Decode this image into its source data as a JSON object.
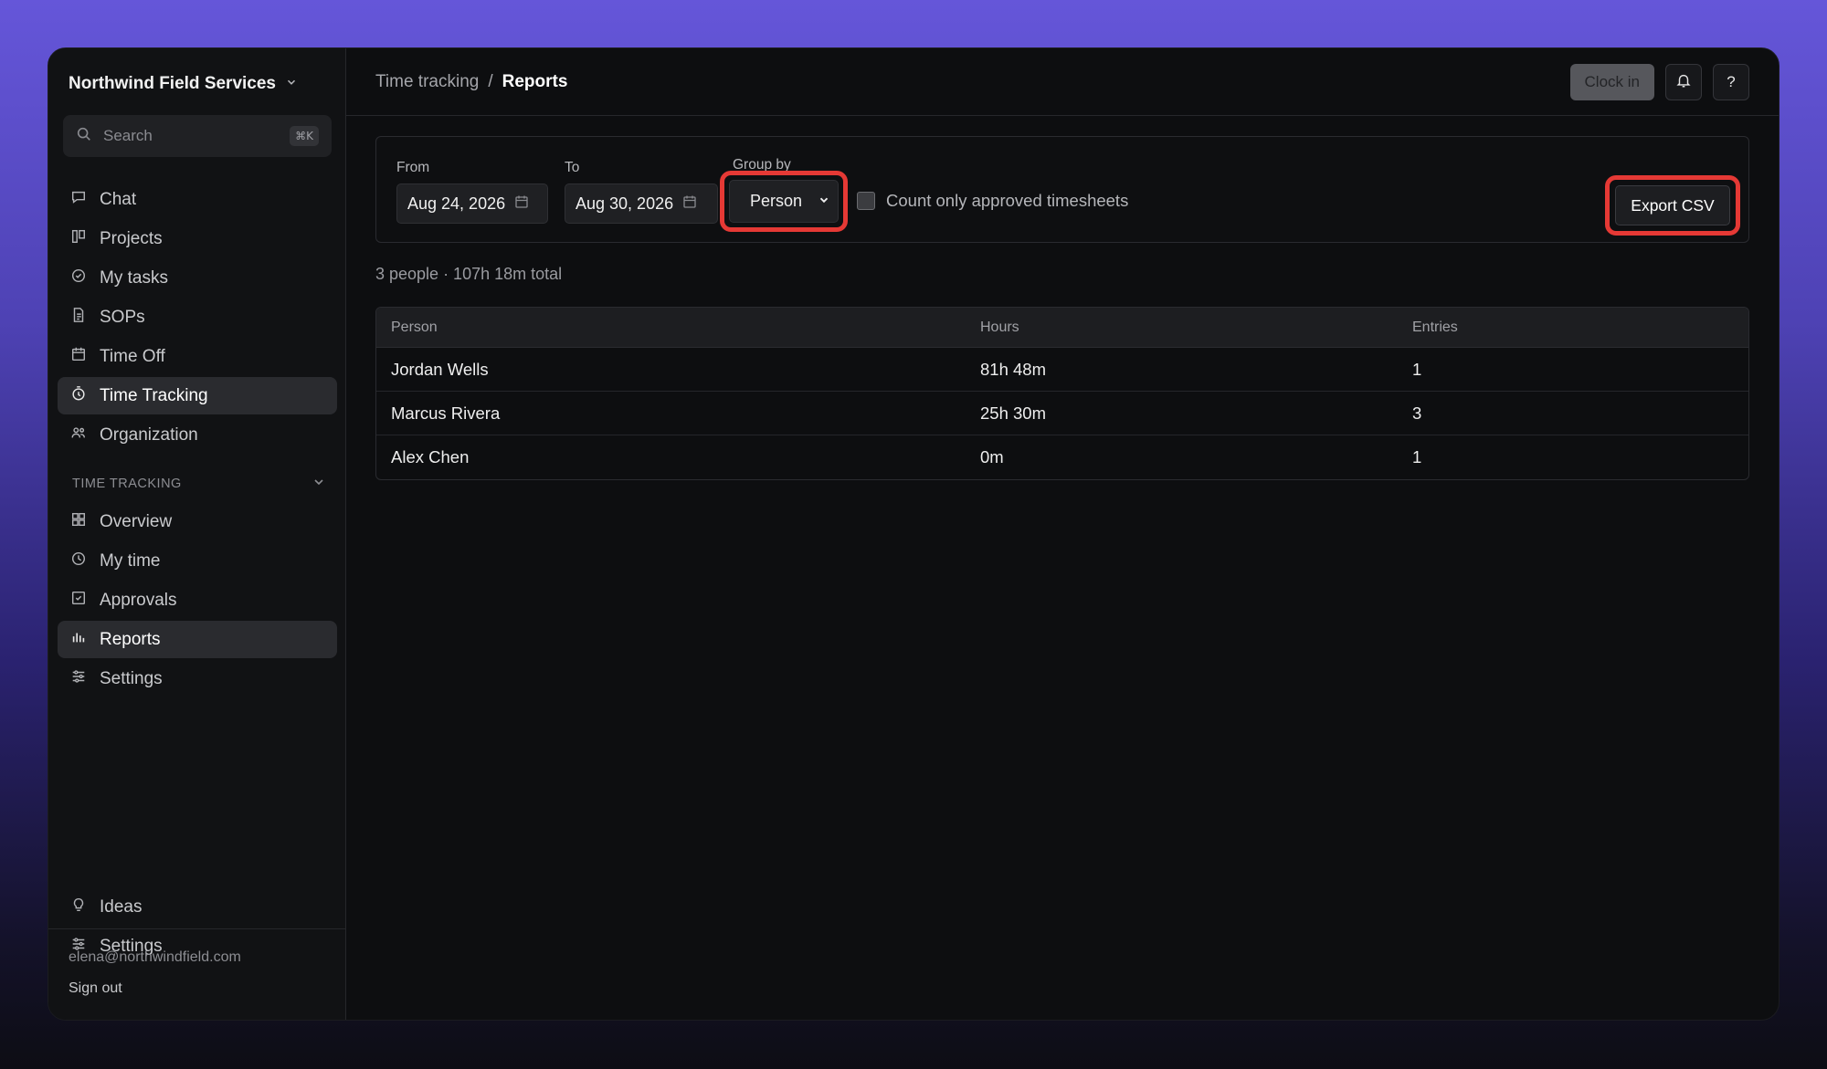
{
  "sidebar": {
    "org_name": "Northwind Field Services",
    "search_placeholder": "Search",
    "search_shortcut": "⌘K",
    "main_items": [
      {
        "label": "Chat",
        "icon": "chat-icon"
      },
      {
        "label": "Projects",
        "icon": "projects-icon"
      },
      {
        "label": "My tasks",
        "icon": "check-circle-icon"
      },
      {
        "label": "SOPs",
        "icon": "document-icon"
      },
      {
        "label": "Time Off",
        "icon": "calendar-icon"
      },
      {
        "label": "Time Tracking",
        "icon": "stopwatch-icon",
        "active": true
      },
      {
        "label": "Organization",
        "icon": "people-icon"
      }
    ],
    "section_title": "TIME TRACKING",
    "section_items": [
      {
        "label": "Overview",
        "icon": "grid-icon"
      },
      {
        "label": "My time",
        "icon": "clock-icon"
      },
      {
        "label": "Approvals",
        "icon": "checkbox-icon"
      },
      {
        "label": "Reports",
        "icon": "bar-chart-icon",
        "active": true
      },
      {
        "label": "Settings",
        "icon": "sliders-icon"
      }
    ],
    "bottom_items": [
      {
        "label": "Ideas",
        "icon": "lightbulb-icon"
      },
      {
        "label": "Settings",
        "icon": "sliders-icon"
      }
    ],
    "user_email": "elena@northwindfield.com",
    "sign_out": "Sign out"
  },
  "topbar": {
    "breadcrumb_parent": "Time tracking",
    "breadcrumb_sep": "/",
    "breadcrumb_current": "Reports",
    "clock_in": "Clock in",
    "help": "?"
  },
  "filters": {
    "from_label": "From",
    "from_value": "Aug 24, 2026",
    "to_label": "To",
    "to_value": "Aug 30, 2026",
    "group_label": "Group by",
    "group_value": "Person",
    "approved_only_label": "Count only approved timesheets",
    "approved_only_checked": false,
    "export_label": "Export CSV"
  },
  "summary": "3 people · 107h 18m total",
  "table": {
    "headers": [
      "Person",
      "Hours",
      "Entries"
    ],
    "rows": [
      [
        "Jordan Wells",
        "81h 48m",
        "1"
      ],
      [
        "Marcus Rivera",
        "25h 30m",
        "3"
      ],
      [
        "Alex Chen",
        "0m",
        "1"
      ]
    ]
  },
  "colors": {
    "highlight": "#e53935",
    "active_bg": "#2a2b2f",
    "background_top": "#6556d9"
  }
}
